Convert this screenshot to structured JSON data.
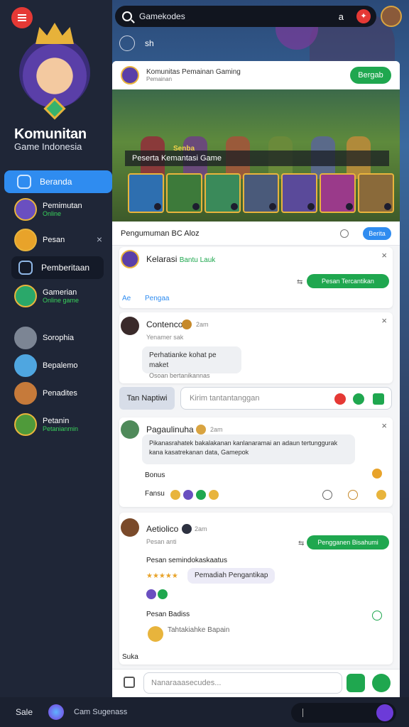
{
  "app": {
    "brand_title": "Komunitan",
    "brand_subtitle": "Game Indonesia"
  },
  "search": {
    "value": "Gamekodes",
    "right_icon_text": "a",
    "hot_icon": "flame-icon"
  },
  "subbar": {
    "label": "sh"
  },
  "sidebar": {
    "nav": [
      {
        "label": "Beranda",
        "active": true,
        "icon": "home-icon"
      },
      {
        "label": "Pemberitaan",
        "active": false,
        "icon": "chart-icon"
      }
    ],
    "channels": [
      {
        "name": "Pemimutan",
        "status": "Online",
        "color": "#6a4fc0"
      },
      {
        "name": "Pesan",
        "status": "",
        "color": "#e8a32a",
        "close": "×"
      },
      {
        "name": "Gamerian",
        "status": "Online game",
        "color": "#2aa86a"
      },
      {
        "name": "Sorophia",
        "status": "",
        "color": "#7c8594"
      },
      {
        "name": "Bepalemo",
        "status": "",
        "color": "#4fa6e0"
      },
      {
        "name": "Penadites",
        "status": "",
        "color": "#c67a3a"
      },
      {
        "name": "Petanin",
        "status": "Petanianmin",
        "color": "#4f9a3a"
      }
    ]
  },
  "panel": {
    "header_title": "Komunitas Pemainan Gaming",
    "header_sub": "Pemainan",
    "header_button": "Bergab",
    "banner_tag": "Senba",
    "banner_caption": "Peserta Kemantasi Game",
    "section_title": "Pengumuman BC Aloz",
    "section_pill": "Berita"
  },
  "posts": [
    {
      "name": "Kelarasi",
      "text_suffix": "Bantu Lauk",
      "button": "Pesan Tercantikan",
      "tabs": [
        "Ae",
        "Pengaa"
      ]
    },
    {
      "name": "Contenco",
      "time": "2am",
      "sub": "Yenamer sak",
      "bubble_line1": "Perhatianke kohat pe maket",
      "bubble_line2": "Osoan bertanikannas"
    },
    {
      "name": "Pagaulinuha",
      "time": "2am",
      "bubble": "Pikanasrahatek bakalakanan kanlanaramai an adaun tertunggurak kana kasatrekanan data, Gamepok",
      "label1": "Bonus",
      "label2": "Fansu"
    },
    {
      "name": "Aetiolico",
      "time": "2am",
      "sub": "Pesan anti",
      "button": "Pengganen Bisahumi",
      "line": "Pesan semindokaskaatus",
      "chip": "Pemadiah Pengantikap",
      "foot1": "Pesan Badiss",
      "foot2": "Tahtakiahke Bapain",
      "foot3": "Suka"
    }
  ],
  "actions": {
    "tab_label": "Tan Naptiwi",
    "input_placeholder": "Kirim tantantanggan"
  },
  "composer": {
    "placeholder": "Nanaraaasecudes..."
  },
  "bottom": {
    "left_label": "Sale",
    "context": "Cam Sugenass"
  }
}
